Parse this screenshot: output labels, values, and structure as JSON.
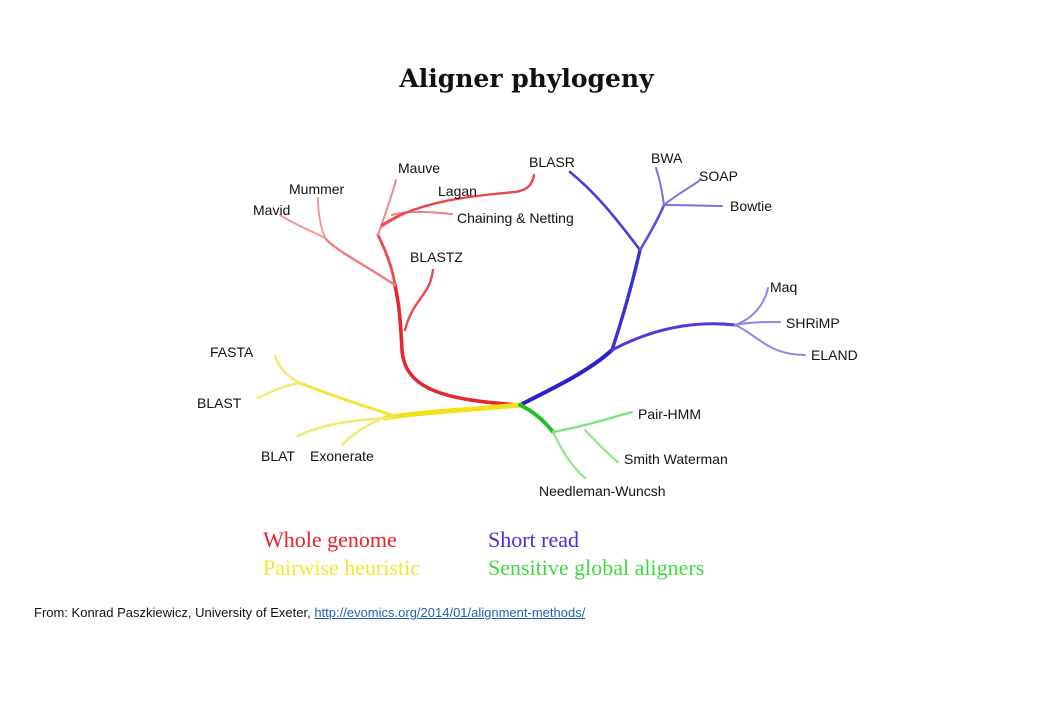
{
  "title": "Aligner phylogeny",
  "colors": {
    "whole_genome": "#e8202a",
    "short_read": "#4b2fd6",
    "pairwise": "#f4e62c",
    "sensitive": "#41d941"
  },
  "labels": {
    "blasr": "BLASR",
    "mauve": "Mauve",
    "mummer": "Mummer",
    "mavid": "Mavid",
    "lagan": "Lagan",
    "chaining": "Chaining & Netting",
    "blastz": "BLASTZ",
    "bwa": "BWA",
    "soap": "SOAP",
    "bowtie": "Bowtie",
    "maq": "Maq",
    "shrimp": "SHRiMP",
    "eland": "ELAND",
    "fasta": "FASTA",
    "blast": "BLAST",
    "blat": "BLAT",
    "exonerate": "Exonerate",
    "pairhmm": "Pair-HMM",
    "smith": "Smith Waterman",
    "needleman": "Needleman-Wuncsh"
  },
  "legend": {
    "whole_genome": "Whole genome",
    "pairwise": "Pairwise heuristic",
    "short_read": "Short read",
    "sensitive": "Sensitive global aligners"
  },
  "source": {
    "prefix": "From: Konrad Paszkiewicz, University of Exeter,",
    "link": "http://evomics.org/2014/01/alignment-methods/"
  }
}
